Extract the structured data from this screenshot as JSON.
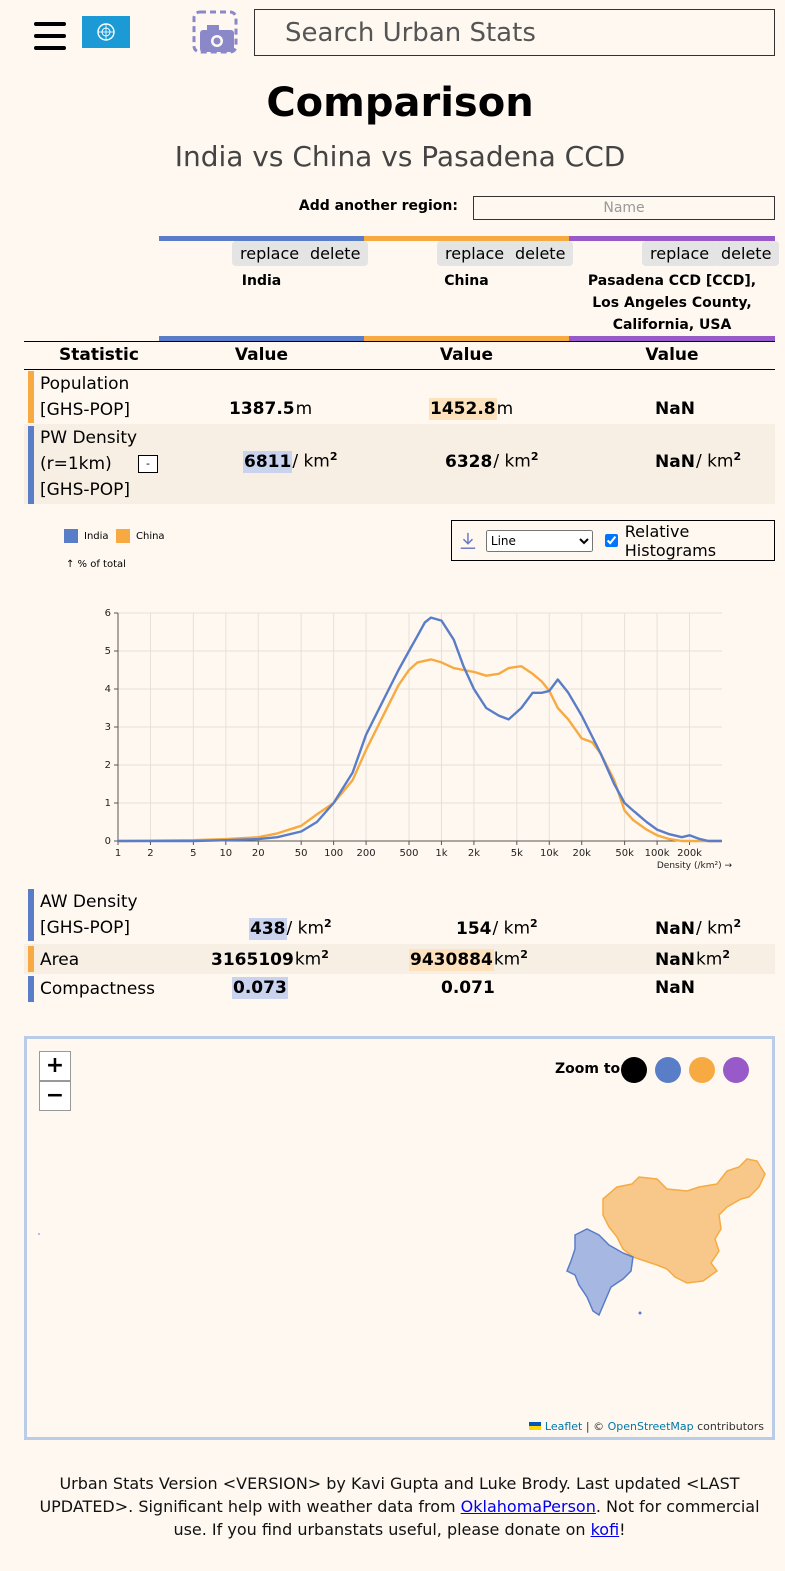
{
  "header": {
    "search_placeholder": "Search Urban Stats"
  },
  "page": {
    "title": "Comparison",
    "subtitle": "India vs China vs Pasadena CCD",
    "add_region_label": "Add another region:",
    "add_region_placeholder": "Name"
  },
  "regions": [
    {
      "name": "India",
      "color": "#5a7dc8",
      "replace": "replace",
      "delete": "delete"
    },
    {
      "name": "China",
      "color": "#f7aa41",
      "replace": "replace",
      "delete": "delete"
    },
    {
      "name": "Pasadena CCD [CCD], Los Angeles County, California, USA",
      "color": "#975ac8",
      "replace": "replace",
      "delete": "delete"
    }
  ],
  "table": {
    "headers": [
      "Statistic",
      "Value",
      "Value",
      "Value"
    ],
    "rows": [
      {
        "name": "Population [GHS-POP]",
        "bar_color": "#f7aa41",
        "values": [
          "1387.5",
          "1452.8",
          "NaN"
        ],
        "units": [
          "m",
          "m",
          ""
        ]
      },
      {
        "name": "PW Density (r=1km) [GHS-POP]",
        "bar_color": "#5a7dc8",
        "values": [
          "6811",
          "6328",
          "NaN"
        ],
        "units": [
          "/ km",
          "/ km",
          "/ km"
        ],
        "expand": "-"
      },
      {
        "name": "AW Density [GHS-POP]",
        "bar_color": "#5a7dc8",
        "values": [
          "438",
          "154",
          "NaN"
        ],
        "units": [
          "/ km",
          "/ km",
          "/ km"
        ]
      },
      {
        "name": "Area",
        "bar_color": "#f7aa41",
        "values": [
          "3165109",
          "9430884",
          "NaN"
        ],
        "units": [
          "km",
          "km",
          "km"
        ]
      },
      {
        "name": "Compactness",
        "bar_color": "#5a7dc8",
        "values": [
          "0.073",
          "0.071",
          "NaN"
        ],
        "units": [
          "",
          "",
          ""
        ]
      }
    ]
  },
  "chart_controls": {
    "select_value": "Line",
    "relative_label": "Relative Histograms",
    "relative_checked": true
  },
  "chart_data": {
    "type": "line",
    "ylabel": "↑ % of total",
    "xlabel": "Density (/km²) →",
    "x_scale": "log",
    "ylim": [
      0,
      6
    ],
    "xlim": [
      1,
      400000
    ],
    "yticks": [
      "0",
      "1",
      "2",
      "3",
      "4",
      "5",
      "6"
    ],
    "xticks": [
      {
        "label": "1",
        "value": 1
      },
      {
        "label": "2",
        "value": 2
      },
      {
        "label": "5",
        "value": 5
      },
      {
        "label": "10",
        "value": 10
      },
      {
        "label": "20",
        "value": 20
      },
      {
        "label": "50",
        "value": 50
      },
      {
        "label": "100",
        "value": 100
      },
      {
        "label": "200",
        "value": 200
      },
      {
        "label": "500",
        "value": 500
      },
      {
        "label": "1k",
        "value": 1000
      },
      {
        "label": "2k",
        "value": 2000
      },
      {
        "label": "5k",
        "value": 5000
      },
      {
        "label": "10k",
        "value": 10000
      },
      {
        "label": "20k",
        "value": 20000
      },
      {
        "label": "50k",
        "value": 50000
      },
      {
        "label": "100k",
        "value": 100000
      },
      {
        "label": "200k",
        "value": 200000
      }
    ],
    "series": [
      {
        "name": "India",
        "color": "#5a7dc8",
        "x": [
          1,
          5,
          10,
          20,
          30,
          50,
          70,
          100,
          150,
          200,
          300,
          400,
          500,
          600,
          700,
          800,
          1000,
          1300,
          1600,
          2000,
          2600,
          3400,
          4200,
          5500,
          7000,
          8500,
          10000,
          12000,
          15000,
          20000,
          30000,
          40000,
          50000,
          60000,
          80000,
          100000,
          130000,
          170000,
          200000,
          250000,
          300000,
          400000
        ],
        "y": [
          0,
          0,
          0.02,
          0.05,
          0.1,
          0.25,
          0.5,
          1.0,
          1.8,
          2.8,
          3.8,
          4.5,
          5.0,
          5.4,
          5.75,
          5.88,
          5.8,
          5.3,
          4.6,
          4.0,
          3.5,
          3.3,
          3.2,
          3.5,
          3.9,
          3.9,
          3.95,
          4.25,
          3.9,
          3.3,
          2.3,
          1.5,
          1.0,
          0.8,
          0.5,
          0.3,
          0.18,
          0.1,
          0.15,
          0.05,
          0,
          0
        ]
      },
      {
        "name": "China",
        "color": "#f7aa41",
        "x": [
          1,
          5,
          10,
          20,
          30,
          50,
          70,
          100,
          150,
          200,
          300,
          400,
          500,
          600,
          800,
          1000,
          1300,
          1600,
          2000,
          2600,
          3400,
          4200,
          5500,
          7000,
          8500,
          10000,
          12000,
          15000,
          20000,
          25000,
          30000,
          40000,
          50000,
          60000,
          80000,
          100000,
          130000,
          170000,
          200000,
          250000,
          400000
        ],
        "y": [
          0,
          0.02,
          0.05,
          0.1,
          0.2,
          0.4,
          0.7,
          1.0,
          1.6,
          2.4,
          3.4,
          4.1,
          4.5,
          4.7,
          4.78,
          4.7,
          4.55,
          4.5,
          4.45,
          4.35,
          4.4,
          4.55,
          4.6,
          4.4,
          4.2,
          3.95,
          3.5,
          3.2,
          2.7,
          2.6,
          2.3,
          1.6,
          0.8,
          0.55,
          0.3,
          0.15,
          0.05,
          0,
          0,
          0,
          0
        ]
      }
    ]
  },
  "map": {
    "zoom_in": "+",
    "zoom_out": "−",
    "zoom_to_label": "Zoom to:",
    "zoom_colors": [
      "#000000",
      "#5a7dc8",
      "#f7aa41",
      "#975ac8"
    ],
    "attrib_leaflet": "Leaflet",
    "attrib_sep": " | © ",
    "attrib_osm": "OpenStreetMap",
    "attrib_tail": " contributors"
  },
  "footer": {
    "t1": "Urban Stats Version <VERSION> by Kavi Gupta and Luke Brody. Last updated <LAST UPDATED>. Significant help with weather data from ",
    "link1": "OklahomaPerson",
    "t2": ". Not for commercial use. If you find urbanstats useful, please donate on ",
    "link2": "kofi",
    "t3": "!"
  }
}
